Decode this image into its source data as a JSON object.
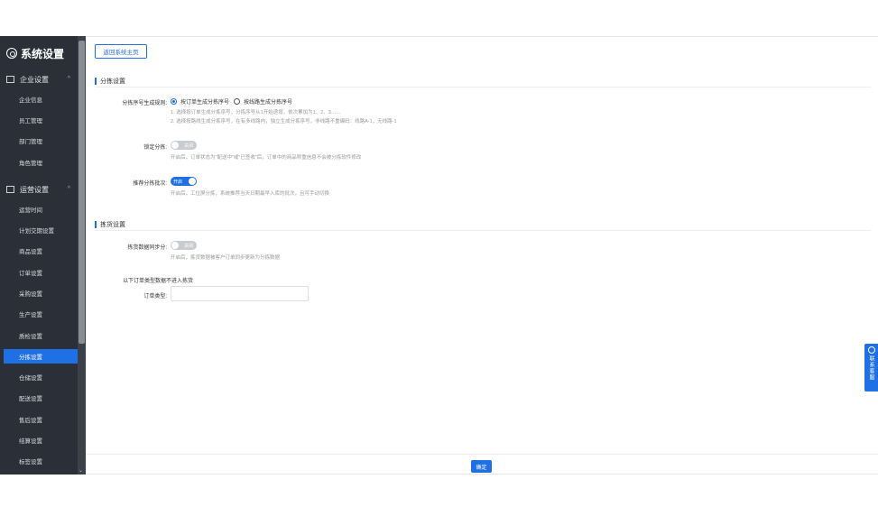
{
  "sidebar": {
    "title": "系统设置",
    "groups": [
      {
        "label": "企业设置",
        "caret": "^"
      },
      {
        "label": "运营设置",
        "caret": "^"
      }
    ],
    "company_items": [
      "企业信息",
      "员工管理",
      "部门管理",
      "角色管理"
    ],
    "ops_items": [
      "运营时间",
      "计划交期设置",
      "商品设置",
      "订单设置",
      "采购设置",
      "生产设置",
      "质检设置",
      "分拣设置",
      "仓储设置",
      "配送设置",
      "售后设置",
      "结算设置",
      "标签设置"
    ],
    "active_item": "分拣设置"
  },
  "toolbar": {
    "back_label": "返回系统主页"
  },
  "section_sort": {
    "title": "分拣设置",
    "rule_label": "分拣序号生成规则:",
    "rule_options": [
      "按订单生成分拣序号",
      "按线路生成分拣序号"
    ],
    "rule_selected": 0,
    "rule_hint_1": "1. 选择按订单生成分拣序号，分拣序号从1开始递增，依次累加为1、2、3……",
    "rule_hint_2": "2. 选择按路线生成分拣序号，在有多线路内，独立生成分拣序号，非线路不重编码：线路A-1，无线路-1",
    "lock_label": "锁定分拣:",
    "lock_state": "关闭",
    "lock_hint": "开启后，订单状态为\"配送中\"或\"已签收\"后，订单中的商品称重信息不会被分拣软件修改",
    "recommend_label": "推荐分拣批次:",
    "recommend_state": "开启",
    "recommend_hint": "开启后，工位屏分拣，系统推荐当天日期最早入库的批次，且可手动切换"
  },
  "section_inspect": {
    "title": "拣货设置",
    "sync_label": "拣货数据同步分:",
    "sync_state": "关闭",
    "sync_hint": "开启后，拣货数据被客户订单同步更新为分拣数据",
    "exclude_text": "以下订单类型数据不进入拣货",
    "order_type_label": "订单类型:",
    "order_type_value": ""
  },
  "footer": {
    "ok_label": "确定"
  },
  "contact": {
    "label": "联系客服"
  },
  "colors": {
    "accent": "#1f6fe5",
    "sidebar_bg": "#2a2f38"
  }
}
